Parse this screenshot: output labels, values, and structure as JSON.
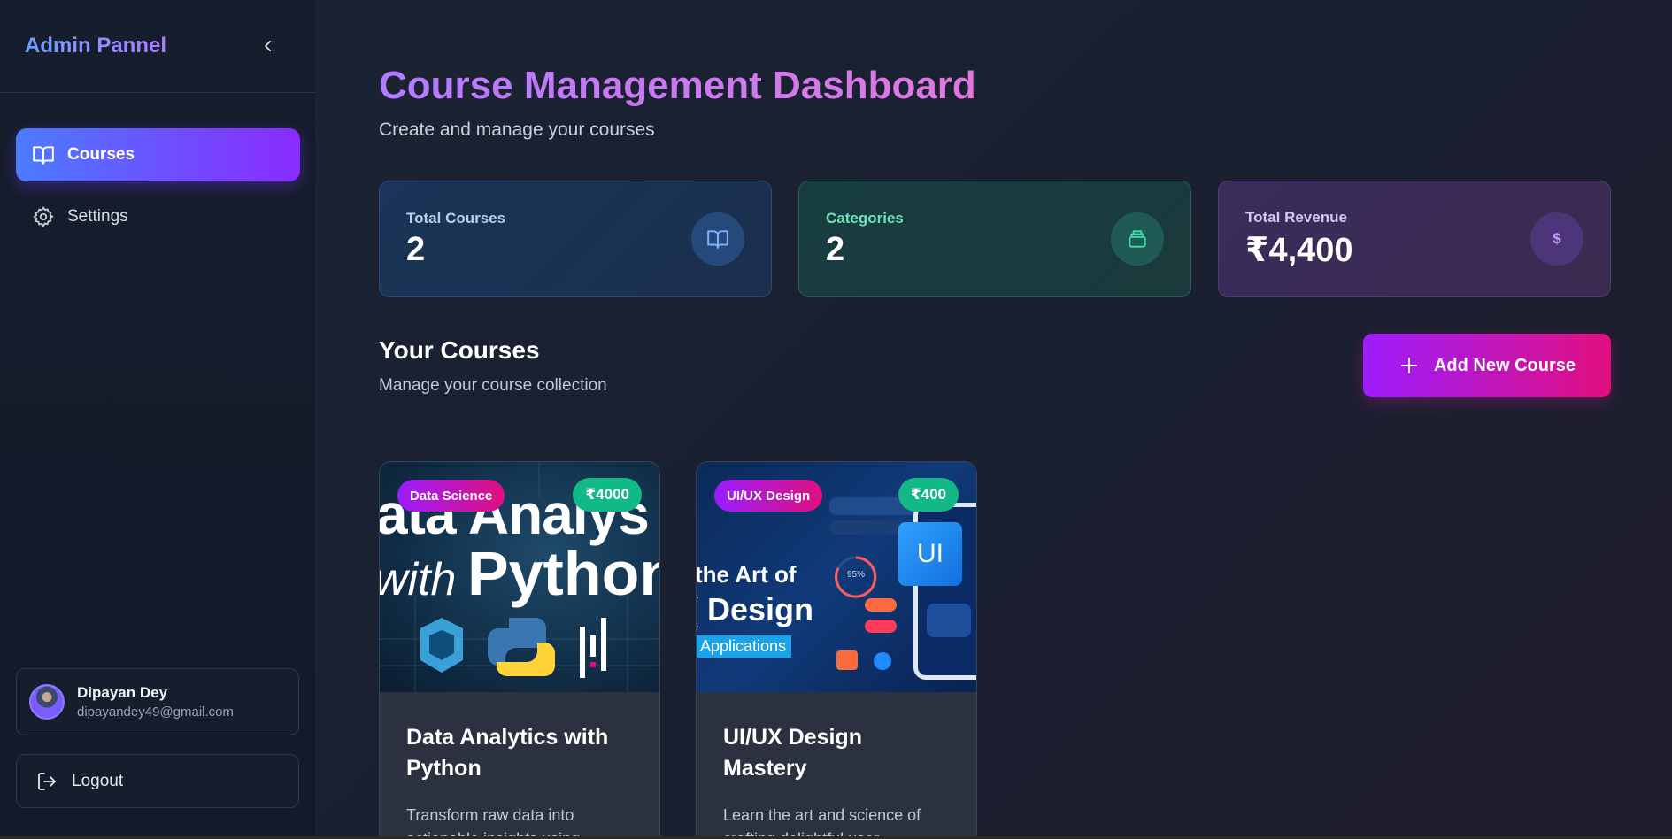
{
  "sidebar": {
    "brand": "Admin Pannel",
    "nav": [
      {
        "label": "Courses",
        "icon": "book-icon",
        "active": true
      },
      {
        "label": "Settings",
        "icon": "gear-icon",
        "active": false
      }
    ],
    "user": {
      "name": "Dipayan Dey",
      "email": "dipayandey49@gmail.com"
    },
    "logout_label": "Logout"
  },
  "header": {
    "title": "Course Management Dashboard",
    "subtitle": "Create and manage your courses"
  },
  "stats": [
    {
      "label": "Total Courses",
      "value": "2",
      "icon": "book-icon"
    },
    {
      "label": "Categories",
      "value": "2",
      "icon": "layers-icon"
    },
    {
      "label": "Total Revenue",
      "value": "₹4,400",
      "icon": "dollar-icon",
      "icon_text": "$"
    }
  ],
  "courses_section": {
    "title": "Your Courses",
    "subtitle": "Manage your course collection",
    "add_button_label": "Add New Course"
  },
  "courses": [
    {
      "category": "Data Science",
      "price": "₹4000",
      "thumb_line1": "ata Analys",
      "thumb_line2_a": "with",
      "thumb_line2_b": "Python",
      "title_line1": "Data Analytics with",
      "title_line2": "Python",
      "desc_line1": "Transform raw data into",
      "desc_line2": "actionable insights using"
    },
    {
      "category": "UI/UX Design",
      "price": "₹400",
      "thumb_line1": "the Art of",
      "thumb_line2": "( Design",
      "thumb_line3": "Applications",
      "thumb_ui": "UI",
      "thumb_pct": "95%",
      "title_line1": "UI/UX Design",
      "title_line2": "Mastery",
      "desc_line1": "Learn the art and science of",
      "desc_line2": "crafting delightful user"
    }
  ],
  "colors": {
    "accent_purple": "#8a2bff",
    "accent_pink": "#e1107e",
    "price_green": "#12b886"
  }
}
